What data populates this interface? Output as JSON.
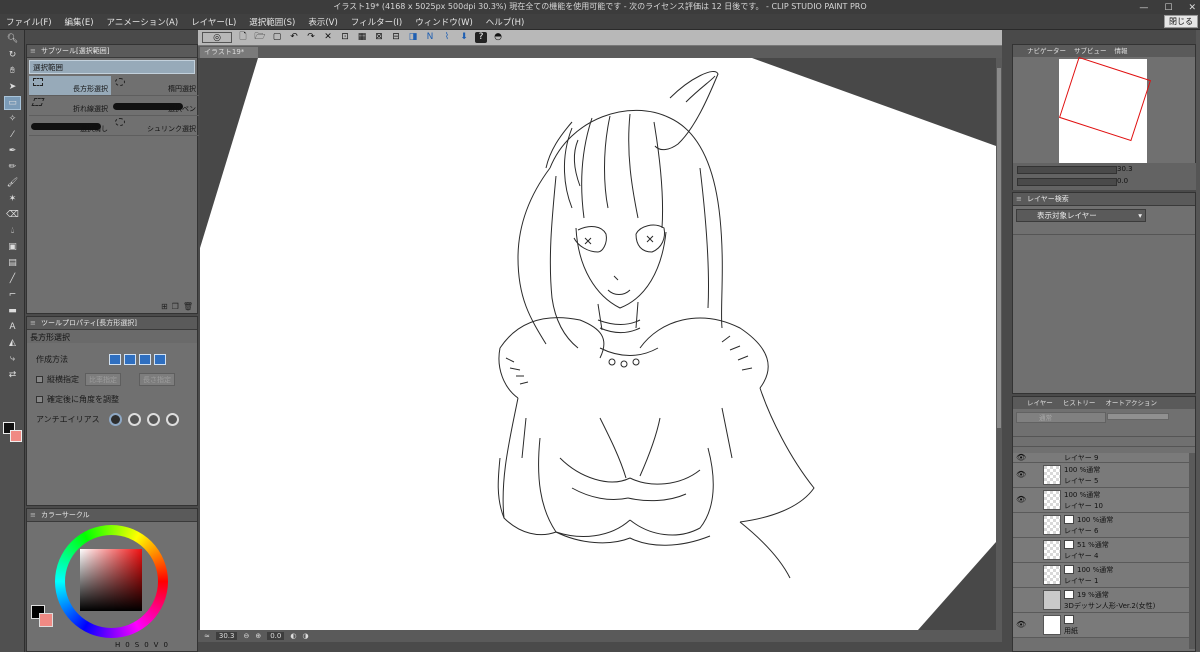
{
  "window": {
    "title": "イラスト19* (4168 x 5025px 500dpi 30.3%)  現在全ての機能を使用可能です - 次のライセンス評価は 12 日後です。 - CLIP STUDIO PAINT PRO",
    "min_label": "—",
    "max_label": "☐",
    "close_label": "✕"
  },
  "menu": {
    "items": [
      "ファイル(F)",
      "編集(E)",
      "アニメーション(A)",
      "レイヤー(L)",
      "選択範囲(S)",
      "表示(V)",
      "フィルター(I)",
      "ウィンドウ(W)",
      "ヘルプ(H)"
    ],
    "close_button": "閉じる"
  },
  "subtool": {
    "header": "サブツール[選択範囲]",
    "group_label": "選択範囲",
    "items": [
      "長方形選択",
      "楕円選択",
      "折れ線選択",
      "選択ペン",
      "選択消し",
      "シュリンク選択"
    ]
  },
  "toolprop": {
    "header": "ツールプロパティ[長方形選択]",
    "subtool_name": "長方形選択",
    "creation_method_label": "作成方法",
    "aspect_label": "縦横指定",
    "ratio_button": "比率指定",
    "size_button": "長さ指定",
    "adjust_angle_label": "確定後に角度を調整",
    "antialias_label": "アンチエイリアス"
  },
  "color": {
    "header": "カラーサークル",
    "readout": [
      "H",
      "0",
      "S",
      "0",
      "V",
      "0"
    ],
    "fg": "#000000",
    "bg": "#f08a84"
  },
  "document": {
    "tab_label": "イラスト19*",
    "zoom": "30.3",
    "angle": "0.0"
  },
  "navigator": {
    "tabs": [
      "ナビゲーター",
      "サブビュー",
      "情報"
    ],
    "zoom_value": "30.3",
    "angle_value": "0.0"
  },
  "layer_search": {
    "tab": "レイヤー検索",
    "dropdown": "表示対象レイヤー"
  },
  "layers": {
    "tabs": [
      "レイヤー",
      "ヒストリー",
      "オートアクション"
    ],
    "blend_mode": "通常",
    "items": [
      {
        "mode": "",
        "name": "レイヤー 9",
        "visible": true,
        "thumb": "clear",
        "mini": false
      },
      {
        "mode": "100 %通常",
        "name": "レイヤー 5",
        "visible": true,
        "thumb": "clear",
        "mini": false
      },
      {
        "mode": "100 %通常",
        "name": "レイヤー 10",
        "visible": true,
        "thumb": "clear",
        "mini": false
      },
      {
        "mode": "100 %通常",
        "name": "レイヤー 6",
        "visible": false,
        "thumb": "clear",
        "mini": true
      },
      {
        "mode": "51 %通常",
        "name": "レイヤー 4",
        "visible": false,
        "thumb": "clear",
        "mini": true
      },
      {
        "mode": "100 %通常",
        "name": "レイヤー 1",
        "visible": false,
        "thumb": "clear",
        "mini": true
      },
      {
        "mode": "19 %通常",
        "name": "3Dデッサン人形-Ver.2(女性)",
        "visible": false,
        "thumb": "doll",
        "mini": true
      },
      {
        "mode": "",
        "name": "用紙",
        "visible": true,
        "thumb": "paper",
        "mini": true
      }
    ]
  }
}
